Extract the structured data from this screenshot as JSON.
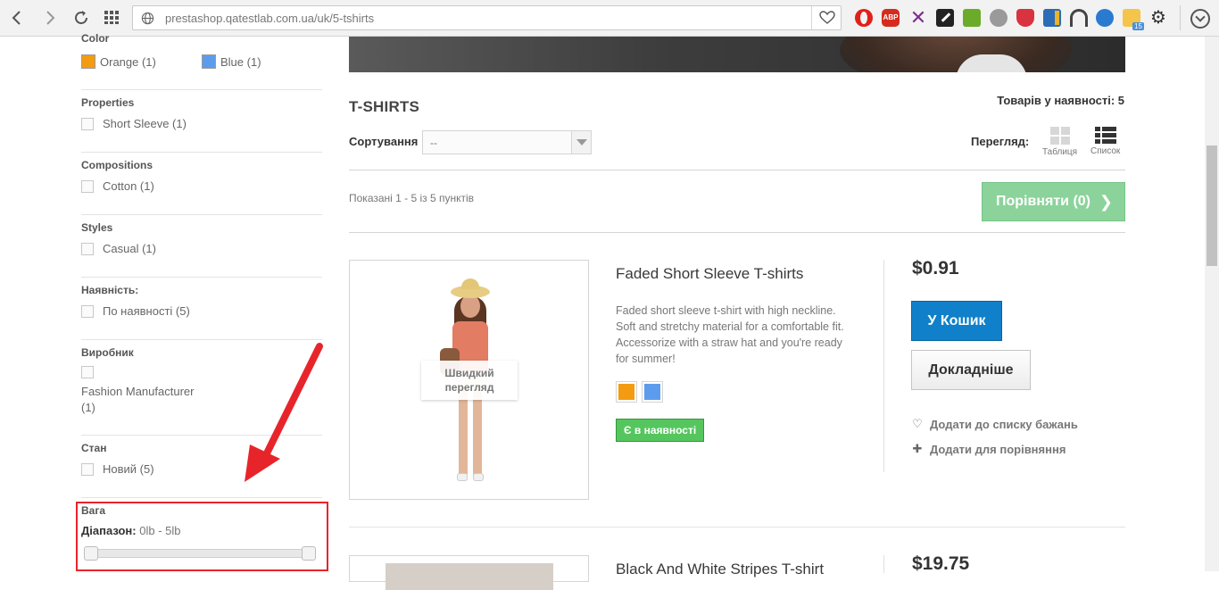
{
  "browser": {
    "url_host": "prestashop.qatestlab.com.ua",
    "url_path": "/uk/5-tshirts"
  },
  "sidebar": {
    "color": {
      "title": "Color",
      "items": [
        {
          "label": "Orange (1)",
          "color": "#f39c11"
        },
        {
          "label": "Blue (1)",
          "color": "#5d9cec"
        }
      ]
    },
    "properties": {
      "title": "Properties",
      "items": [
        {
          "label": "Short Sleeve (1)"
        }
      ]
    },
    "compositions": {
      "title": "Compositions",
      "items": [
        {
          "label": "Cotton (1)"
        }
      ]
    },
    "styles": {
      "title": "Styles",
      "items": [
        {
          "label": "Casual (1)"
        }
      ]
    },
    "availability": {
      "title": "Наявність:",
      "items": [
        {
          "label": "По наявності (5)"
        }
      ]
    },
    "manufacturer": {
      "title": "Виробник",
      "items": [
        {
          "label_line1": "Fashion Manufacturer",
          "label_line2": "(1)"
        }
      ]
    },
    "condition": {
      "title": "Стан",
      "items": [
        {
          "label": "Новий (5)"
        }
      ]
    },
    "weight": {
      "title": "Вага",
      "range_label": "Діапазон:",
      "range_value": "0lb - 5lb"
    }
  },
  "category": {
    "title": "T-SHIRTS",
    "in_stock": "Товарів у наявності: 5",
    "sort_label": "Сортування",
    "sort_value": "--",
    "view_label": "Перегляд:",
    "view_grid": "Таблиця",
    "view_list": "Список",
    "showing": "Показані 1 - 5 із 5 пунктів",
    "compare_button": "Порівняти (0)"
  },
  "products": [
    {
      "name": "Faded Short Sleeve T-shirts",
      "description": "Faded short sleeve t-shirt with high neckline. Soft and stretchy material for a comfortable fit. Accessorize with a straw hat and you're ready for summer!",
      "colors": [
        "#f39c11",
        "#5d9cec"
      ],
      "availability": "Є в наявності",
      "price": "$0.91",
      "quick_view": "Швидкий перегляд",
      "add_to_cart": "У Кошик",
      "more": "Докладніше",
      "wishlist": "Додати до списку бажань",
      "compare": "Додати для порівняння"
    },
    {
      "name": "Black And White Stripes T-shirt",
      "price": "$19.75"
    }
  ]
}
